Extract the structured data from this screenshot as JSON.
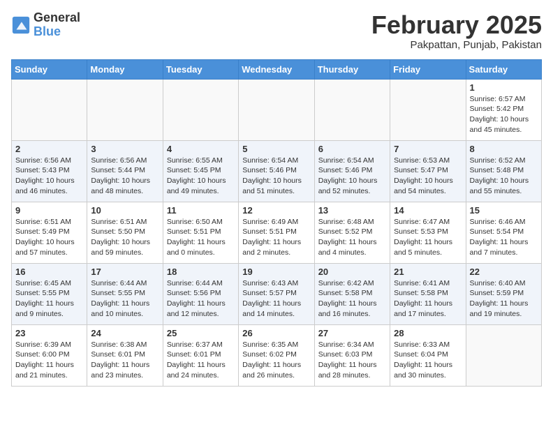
{
  "logo": {
    "general": "General",
    "blue": "Blue"
  },
  "title": "February 2025",
  "subtitle": "Pakpattan, Punjab, Pakistan",
  "days_of_week": [
    "Sunday",
    "Monday",
    "Tuesday",
    "Wednesday",
    "Thursday",
    "Friday",
    "Saturday"
  ],
  "weeks": [
    {
      "alt": false,
      "days": [
        {
          "num": "",
          "info": ""
        },
        {
          "num": "",
          "info": ""
        },
        {
          "num": "",
          "info": ""
        },
        {
          "num": "",
          "info": ""
        },
        {
          "num": "",
          "info": ""
        },
        {
          "num": "",
          "info": ""
        },
        {
          "num": "1",
          "info": "Sunrise: 6:57 AM\nSunset: 5:42 PM\nDaylight: 10 hours\nand 45 minutes."
        }
      ]
    },
    {
      "alt": true,
      "days": [
        {
          "num": "2",
          "info": "Sunrise: 6:56 AM\nSunset: 5:43 PM\nDaylight: 10 hours\nand 46 minutes."
        },
        {
          "num": "3",
          "info": "Sunrise: 6:56 AM\nSunset: 5:44 PM\nDaylight: 10 hours\nand 48 minutes."
        },
        {
          "num": "4",
          "info": "Sunrise: 6:55 AM\nSunset: 5:45 PM\nDaylight: 10 hours\nand 49 minutes."
        },
        {
          "num": "5",
          "info": "Sunrise: 6:54 AM\nSunset: 5:46 PM\nDaylight: 10 hours\nand 51 minutes."
        },
        {
          "num": "6",
          "info": "Sunrise: 6:54 AM\nSunset: 5:46 PM\nDaylight: 10 hours\nand 52 minutes."
        },
        {
          "num": "7",
          "info": "Sunrise: 6:53 AM\nSunset: 5:47 PM\nDaylight: 10 hours\nand 54 minutes."
        },
        {
          "num": "8",
          "info": "Sunrise: 6:52 AM\nSunset: 5:48 PM\nDaylight: 10 hours\nand 55 minutes."
        }
      ]
    },
    {
      "alt": false,
      "days": [
        {
          "num": "9",
          "info": "Sunrise: 6:51 AM\nSunset: 5:49 PM\nDaylight: 10 hours\nand 57 minutes."
        },
        {
          "num": "10",
          "info": "Sunrise: 6:51 AM\nSunset: 5:50 PM\nDaylight: 10 hours\nand 59 minutes."
        },
        {
          "num": "11",
          "info": "Sunrise: 6:50 AM\nSunset: 5:51 PM\nDaylight: 11 hours\nand 0 minutes."
        },
        {
          "num": "12",
          "info": "Sunrise: 6:49 AM\nSunset: 5:51 PM\nDaylight: 11 hours\nand 2 minutes."
        },
        {
          "num": "13",
          "info": "Sunrise: 6:48 AM\nSunset: 5:52 PM\nDaylight: 11 hours\nand 4 minutes."
        },
        {
          "num": "14",
          "info": "Sunrise: 6:47 AM\nSunset: 5:53 PM\nDaylight: 11 hours\nand 5 minutes."
        },
        {
          "num": "15",
          "info": "Sunrise: 6:46 AM\nSunset: 5:54 PM\nDaylight: 11 hours\nand 7 minutes."
        }
      ]
    },
    {
      "alt": true,
      "days": [
        {
          "num": "16",
          "info": "Sunrise: 6:45 AM\nSunset: 5:55 PM\nDaylight: 11 hours\nand 9 minutes."
        },
        {
          "num": "17",
          "info": "Sunrise: 6:44 AM\nSunset: 5:55 PM\nDaylight: 11 hours\nand 10 minutes."
        },
        {
          "num": "18",
          "info": "Sunrise: 6:44 AM\nSunset: 5:56 PM\nDaylight: 11 hours\nand 12 minutes."
        },
        {
          "num": "19",
          "info": "Sunrise: 6:43 AM\nSunset: 5:57 PM\nDaylight: 11 hours\nand 14 minutes."
        },
        {
          "num": "20",
          "info": "Sunrise: 6:42 AM\nSunset: 5:58 PM\nDaylight: 11 hours\nand 16 minutes."
        },
        {
          "num": "21",
          "info": "Sunrise: 6:41 AM\nSunset: 5:58 PM\nDaylight: 11 hours\nand 17 minutes."
        },
        {
          "num": "22",
          "info": "Sunrise: 6:40 AM\nSunset: 5:59 PM\nDaylight: 11 hours\nand 19 minutes."
        }
      ]
    },
    {
      "alt": false,
      "days": [
        {
          "num": "23",
          "info": "Sunrise: 6:39 AM\nSunset: 6:00 PM\nDaylight: 11 hours\nand 21 minutes."
        },
        {
          "num": "24",
          "info": "Sunrise: 6:38 AM\nSunset: 6:01 PM\nDaylight: 11 hours\nand 23 minutes."
        },
        {
          "num": "25",
          "info": "Sunrise: 6:37 AM\nSunset: 6:01 PM\nDaylight: 11 hours\nand 24 minutes."
        },
        {
          "num": "26",
          "info": "Sunrise: 6:35 AM\nSunset: 6:02 PM\nDaylight: 11 hours\nand 26 minutes."
        },
        {
          "num": "27",
          "info": "Sunrise: 6:34 AM\nSunset: 6:03 PM\nDaylight: 11 hours\nand 28 minutes."
        },
        {
          "num": "28",
          "info": "Sunrise: 6:33 AM\nSunset: 6:04 PM\nDaylight: 11 hours\nand 30 minutes."
        },
        {
          "num": "",
          "info": ""
        }
      ]
    }
  ]
}
